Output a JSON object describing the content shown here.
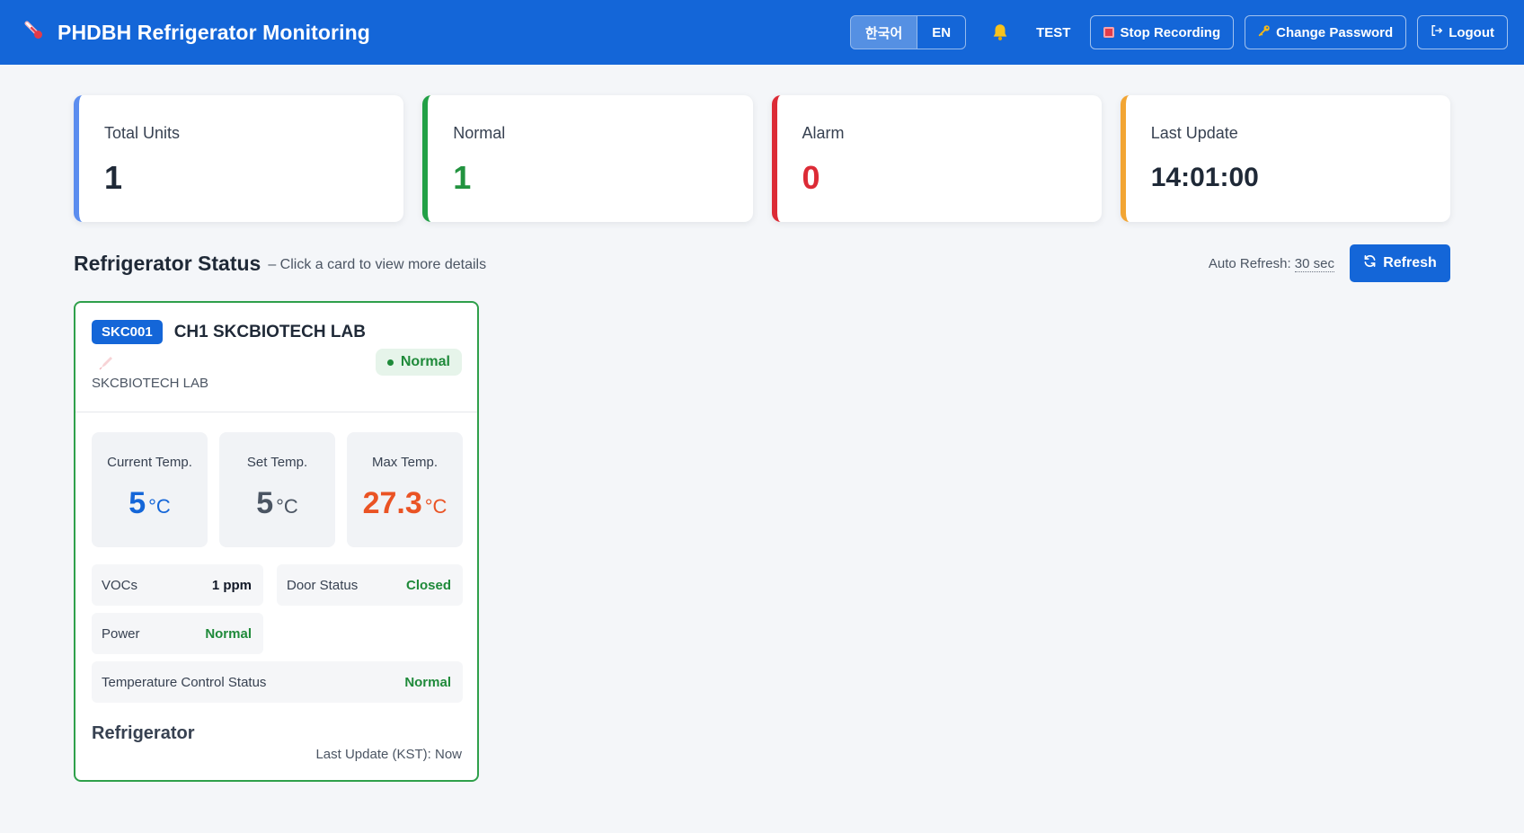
{
  "header": {
    "title": "PHDBH Refrigerator Monitoring",
    "lang_ko": "한국어",
    "lang_en": "EN",
    "user": "TEST",
    "stop_recording": "Stop Recording",
    "change_password": "Change Password",
    "logout": "Logout"
  },
  "summary": {
    "total_label": "Total Units",
    "total_value": "1",
    "normal_label": "Normal",
    "normal_value": "1",
    "alarm_label": "Alarm",
    "alarm_value": "0",
    "update_label": "Last Update",
    "update_value": "14:01:00"
  },
  "section": {
    "title": "Refrigerator Status",
    "subtitle": "– Click a card to view more details",
    "auto_refresh_prefix": "Auto Refresh: ",
    "auto_refresh_value": "30 sec",
    "refresh_button": "Refresh"
  },
  "fridge": {
    "code": "SKC001",
    "name": "CH1 SKCBIOTECH LAB",
    "location": "SKCBIOTECH LAB",
    "status": "Normal",
    "current_temp_label": "Current Temp.",
    "current_temp": "5",
    "set_temp_label": "Set Temp.",
    "set_temp": "5",
    "max_temp_label": "Max Temp.",
    "max_temp": "27.3",
    "unit": "°C",
    "vocs_label": "VOCs",
    "vocs_value": "1 ppm",
    "door_label": "Door Status",
    "door_value": "Closed",
    "power_label": "Power",
    "power_value": "Normal",
    "tcs_label": "Temperature Control Status",
    "tcs_value": "Normal",
    "type": "Refrigerator",
    "last_update": "Last Update (KST): Now"
  },
  "colors": {
    "header_bg": "#1466d8",
    "normal": "#22933f",
    "alarm": "#dc2b36",
    "max_temp": "#ea5324",
    "accent": "#1466d8"
  },
  "icons": {
    "brand": "thermometer-icon",
    "bell": "bell-icon",
    "record": "record-icon",
    "key": "key-icon",
    "logout": "logout-icon",
    "refresh": "refresh-icon",
    "location": "pin-icon"
  }
}
